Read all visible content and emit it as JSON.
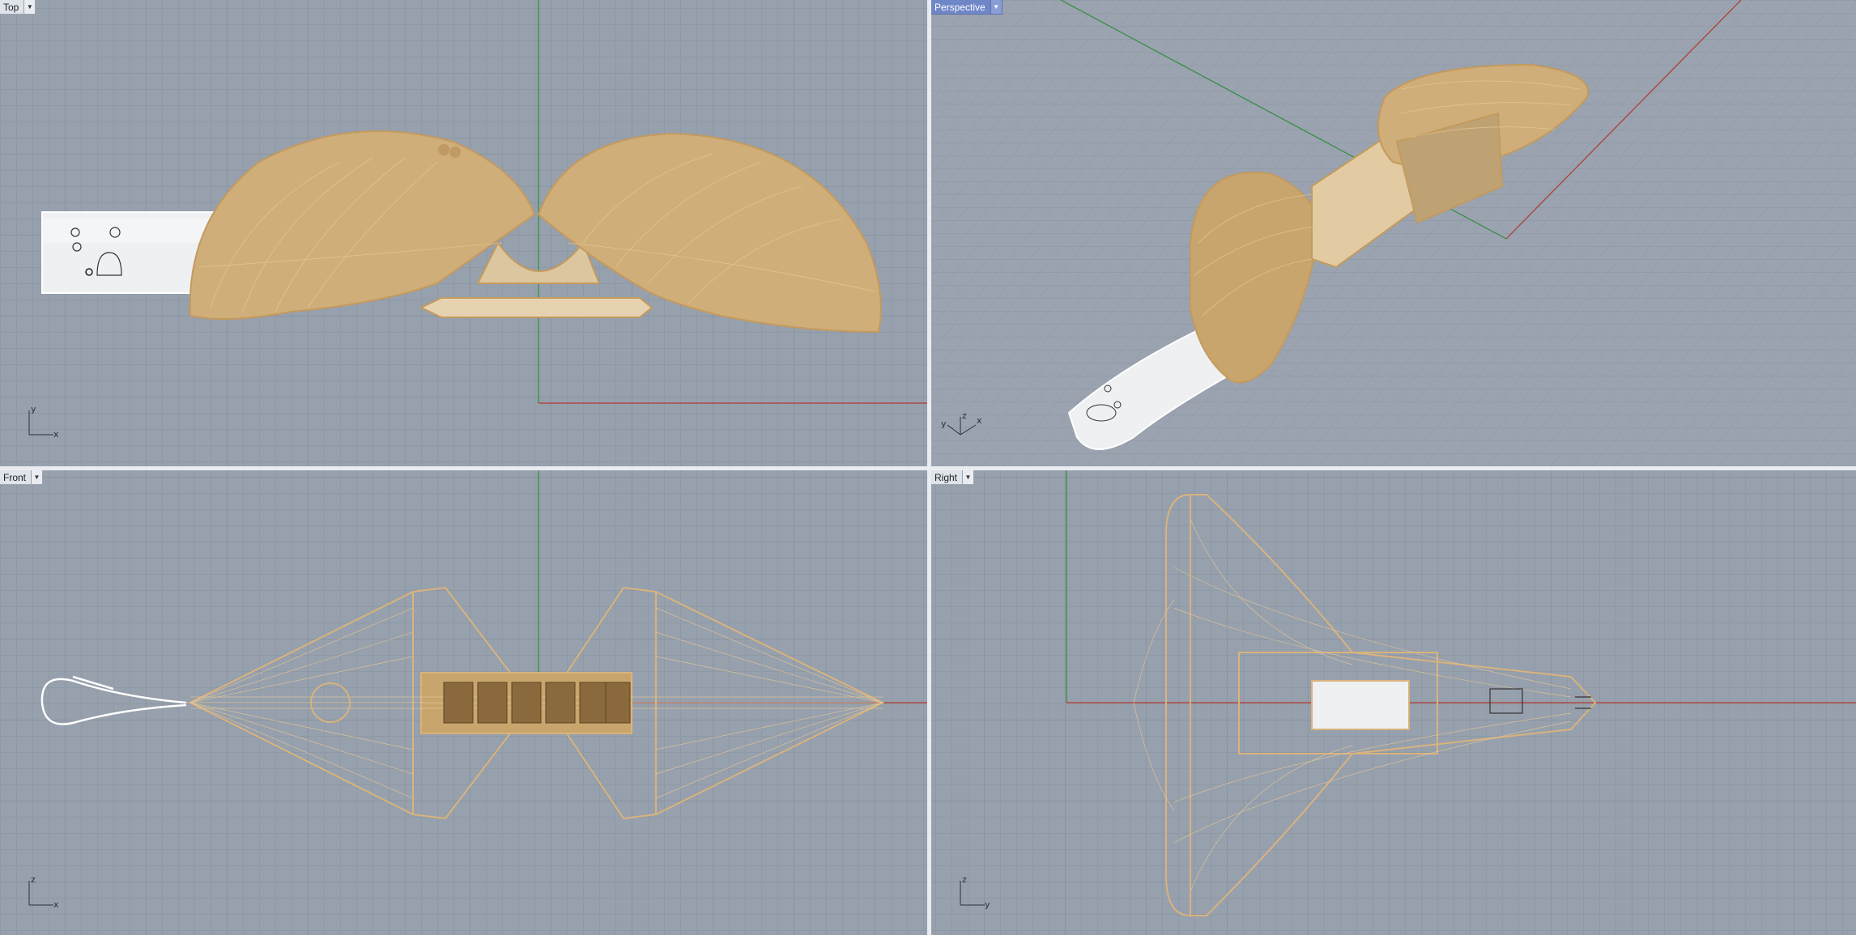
{
  "viewports": {
    "top": {
      "label": "Top",
      "axis_h": "x",
      "axis_v": "y",
      "active": false
    },
    "perspective": {
      "label": "Perspective",
      "axis_a": "y",
      "axis_b": "z",
      "axis_c": "x",
      "active": true
    },
    "front": {
      "label": "Front",
      "axis_h": "x",
      "axis_v": "z",
      "active": false
    },
    "right": {
      "label": "Right",
      "axis_h": "y",
      "axis_v": "z",
      "active": false
    }
  },
  "icons": {
    "dropdown": "chevron-down-icon"
  },
  "colors": {
    "grid_bg": "#97a0ad",
    "x_axis": "#b23a2e",
    "y_axis": "#2f8f3a",
    "model": "#d9b37c",
    "active_tab": "#6f86c7"
  }
}
